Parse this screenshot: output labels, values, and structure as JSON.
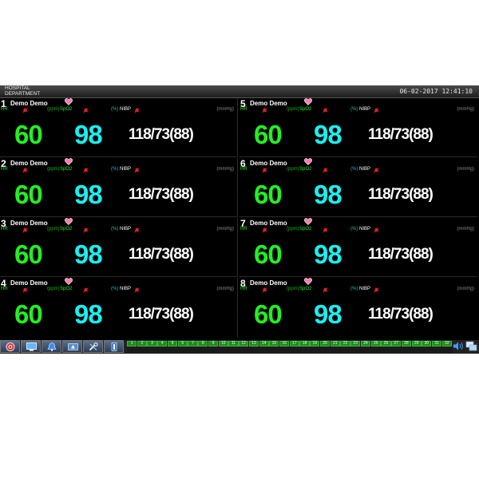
{
  "header": {
    "hospital_line1": "HOSPITAL",
    "hospital_line2": "DEPARTMENT",
    "datetime": "06-02-2017 12:41:10"
  },
  "labels": {
    "hr": "HR",
    "ppm": "(ppm)",
    "spo2": "SpO2",
    "pct": "(%)",
    "nibp": "NIBP",
    "mmhg": "(mmHg)"
  },
  "patients": [
    {
      "num": "1",
      "name": "Demo Demo",
      "hr": "60",
      "spo2": "98",
      "nibp": "118/73(88)"
    },
    {
      "num": "2",
      "name": "Demo Demo",
      "hr": "60",
      "spo2": "98",
      "nibp": "118/73(88)"
    },
    {
      "num": "3",
      "name": "Demo Demo",
      "hr": "60",
      "spo2": "98",
      "nibp": "118/73(88)"
    },
    {
      "num": "4",
      "name": "Demo Demo",
      "hr": "60",
      "spo2": "98",
      "nibp": "118/73(88)"
    },
    {
      "num": "5",
      "name": "Demo Demo",
      "hr": "60",
      "spo2": "98",
      "nibp": "118/73(88)"
    },
    {
      "num": "6",
      "name": "Demo Demo",
      "hr": "60",
      "spo2": "98",
      "nibp": "118/73(88)"
    },
    {
      "num": "7",
      "name": "Demo Demo",
      "hr": "60",
      "spo2": "98",
      "nibp": "118/73(88)"
    },
    {
      "num": "8",
      "name": "Demo Demo",
      "hr": "60",
      "spo2": "98",
      "nibp": "118/73(88)"
    }
  ],
  "toolbar": {
    "buttons": [
      "alarm-reset-icon",
      "monitor-view-icon",
      "alarm-bell-icon",
      "network-icon",
      "tools-icon",
      "record-icon"
    ]
  },
  "bed_numbers": [
    "1",
    "2",
    "3",
    "4",
    "5",
    "6",
    "7",
    "8",
    "9",
    "10",
    "11",
    "12",
    "13",
    "14",
    "15",
    "16",
    "17",
    "18",
    "19",
    "20",
    "21",
    "22",
    "23",
    "24",
    "25",
    "26",
    "27",
    "28",
    "29",
    "30",
    "31",
    "32"
  ],
  "colors": {
    "hr": "#22f022",
    "spo2": "#19f0f0",
    "nibp": "#ffffff",
    "bed_active": "#1f8a1f",
    "background": "#000000"
  }
}
